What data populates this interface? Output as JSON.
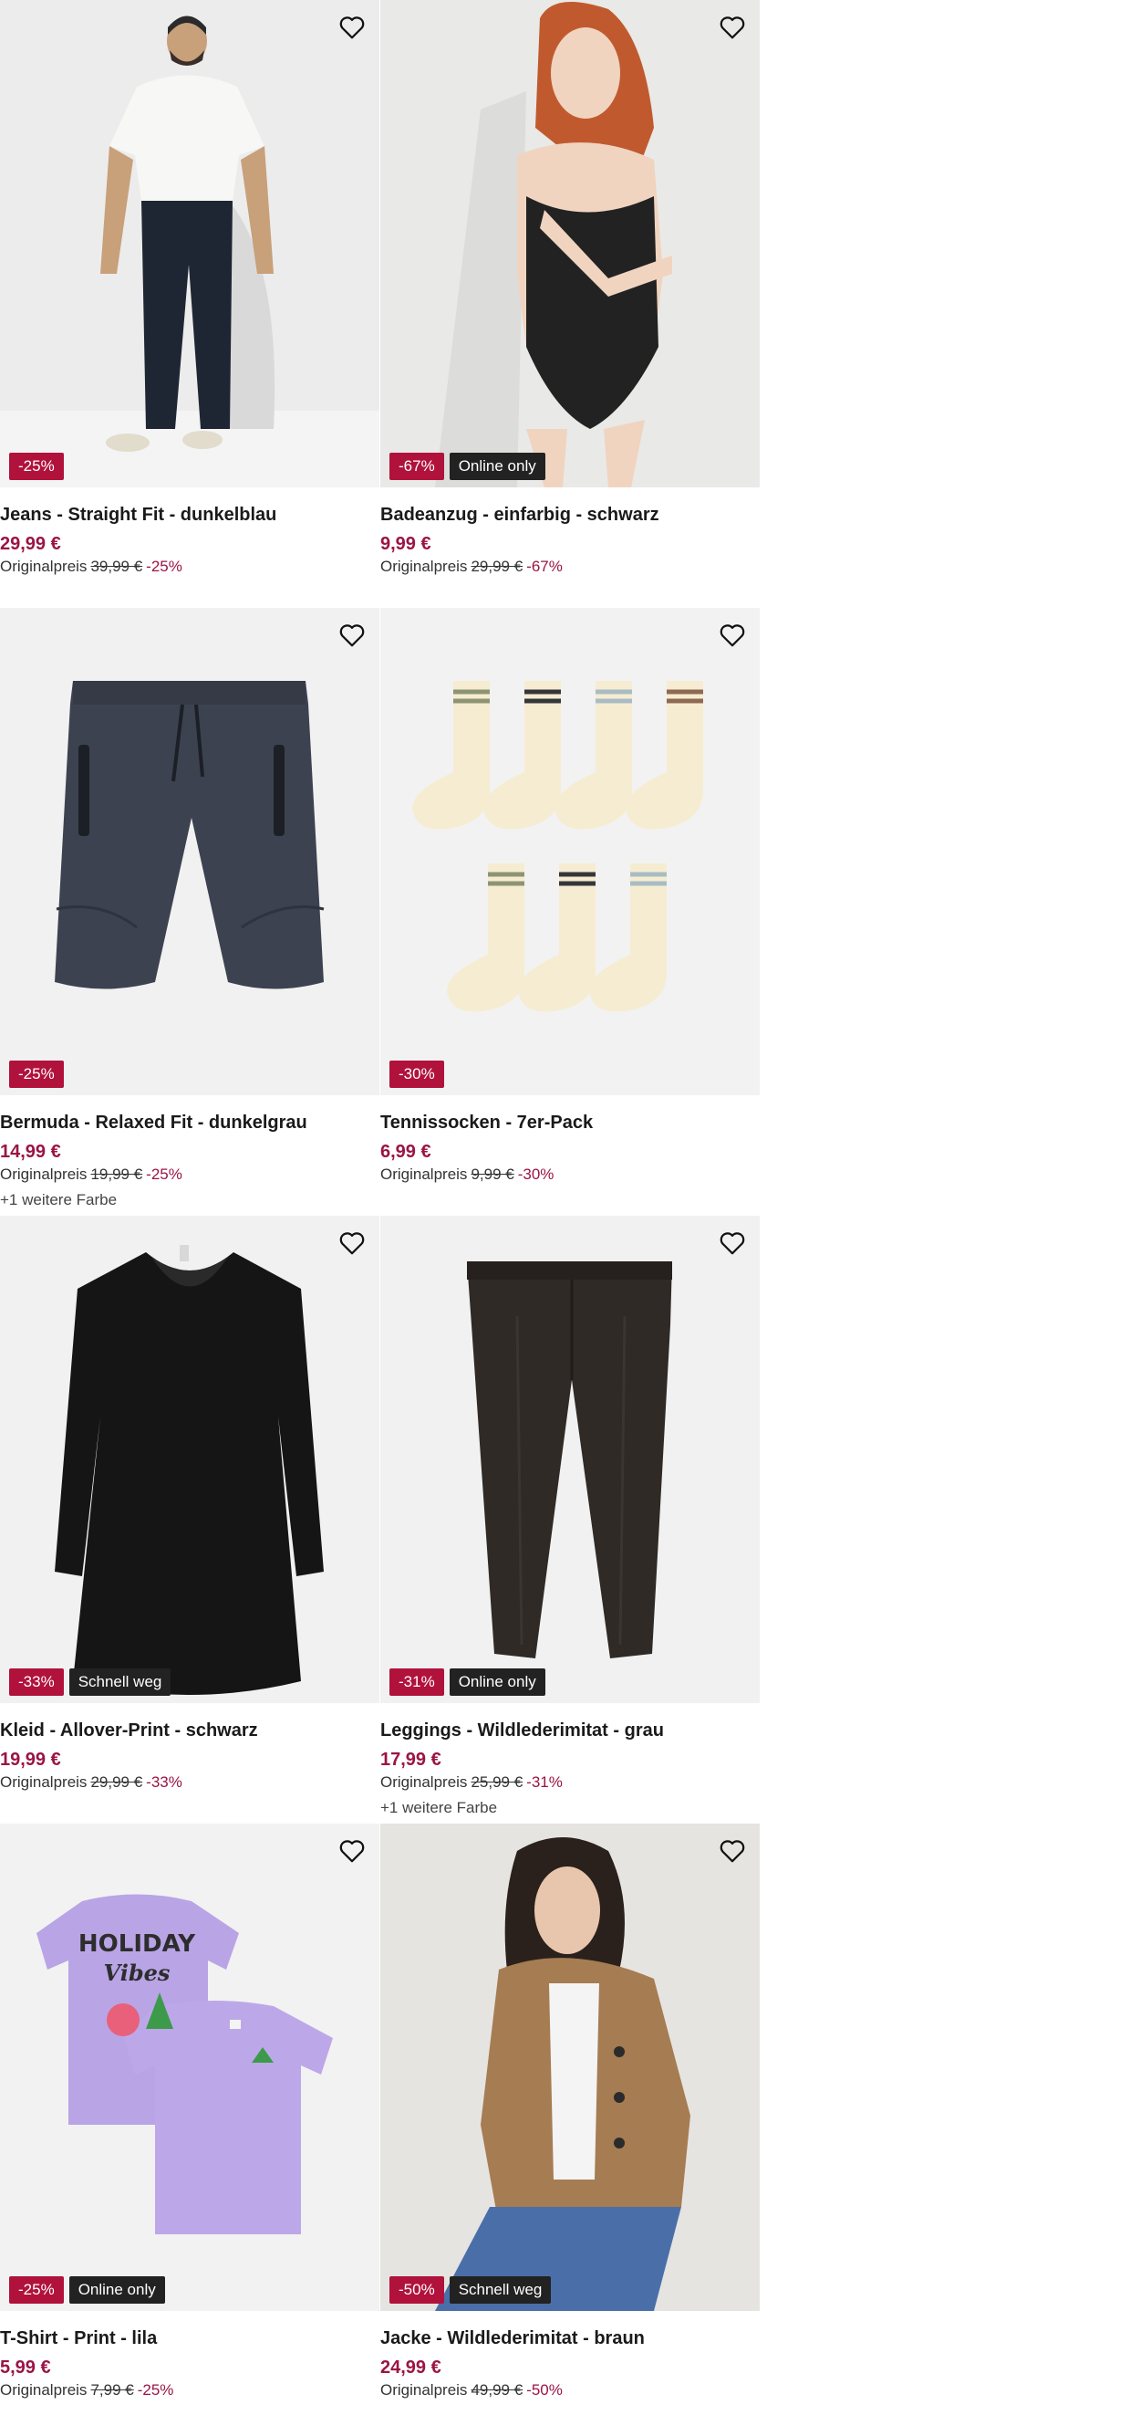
{
  "accent_color": "#9b1445",
  "discount_badge_color": "#b0123c",
  "tag_badge_color": "#222222",
  "wishlist_icon": "heart-icon",
  "products": [
    {
      "title": "Jeans - Straight Fit - dunkelblau",
      "price": "29,99 €",
      "orig_label": "Originalpreis",
      "orig_price": "39,99 €",
      "orig_pct": "-25%",
      "badge_discount": "-25%",
      "badge_tag": "",
      "more": "",
      "image": "man-white-tee-dark-jeans"
    },
    {
      "title": "Badeanzug - einfarbig - schwarz",
      "price": "9,99 €",
      "orig_label": "Originalpreis",
      "orig_price": "29,99 €",
      "orig_pct": "-67%",
      "badge_discount": "-67%",
      "badge_tag": "Online only",
      "more": "",
      "image": "woman-black-swimsuit"
    },
    {
      "title": "Bermuda - Relaxed Fit - dunkelgrau",
      "price": "14,99 €",
      "orig_label": "Originalpreis",
      "orig_price": "19,99 €",
      "orig_pct": "-25%",
      "badge_discount": "-25%",
      "badge_tag": "",
      "more": "+1 weitere Farbe",
      "image": "dark-grey-bermuda-shorts"
    },
    {
      "title": "Tennissocken - 7er-Pack",
      "price": "6,99 €",
      "orig_label": "Originalpreis",
      "orig_price": "9,99 €",
      "orig_pct": "-30%",
      "badge_discount": "-30%",
      "badge_tag": "",
      "more": "",
      "image": "seven-tennis-socks"
    },
    {
      "title": "Kleid - Allover-Print - schwarz",
      "price": "19,99 €",
      "orig_label": "Originalpreis",
      "orig_price": "29,99 €",
      "orig_pct": "-33%",
      "badge_discount": "-33%",
      "badge_tag": "Schnell weg",
      "more": "",
      "image": "black-dress"
    },
    {
      "title": "Leggings - Wildlederimitat - grau",
      "price": "17,99 €",
      "orig_label": "Originalpreis",
      "orig_price": "25,99 €",
      "orig_pct": "-31%",
      "badge_discount": "-31%",
      "badge_tag": "Online only",
      "more": "+1 weitere Farbe",
      "image": "grey-suede-leggings"
    },
    {
      "title": "T-Shirt - Print - lila",
      "price": "5,99 €",
      "orig_label": "Originalpreis",
      "orig_price": "7,99 €",
      "orig_pct": "-25%",
      "badge_discount": "-25%",
      "badge_tag": "Online only",
      "more": "",
      "image": "lilac-tshirts-holiday-vibes",
      "print_text": [
        "HOLIDAY",
        "Vibes"
      ]
    },
    {
      "title": "Jacke - Wildlederimitat - braun",
      "price": "24,99 €",
      "orig_label": "Originalpreis",
      "orig_price": "49,99 €",
      "orig_pct": "-50%",
      "badge_discount": "-50%",
      "badge_tag": "Schnell weg",
      "more": "",
      "image": "woman-brown-suede-jacket"
    }
  ]
}
